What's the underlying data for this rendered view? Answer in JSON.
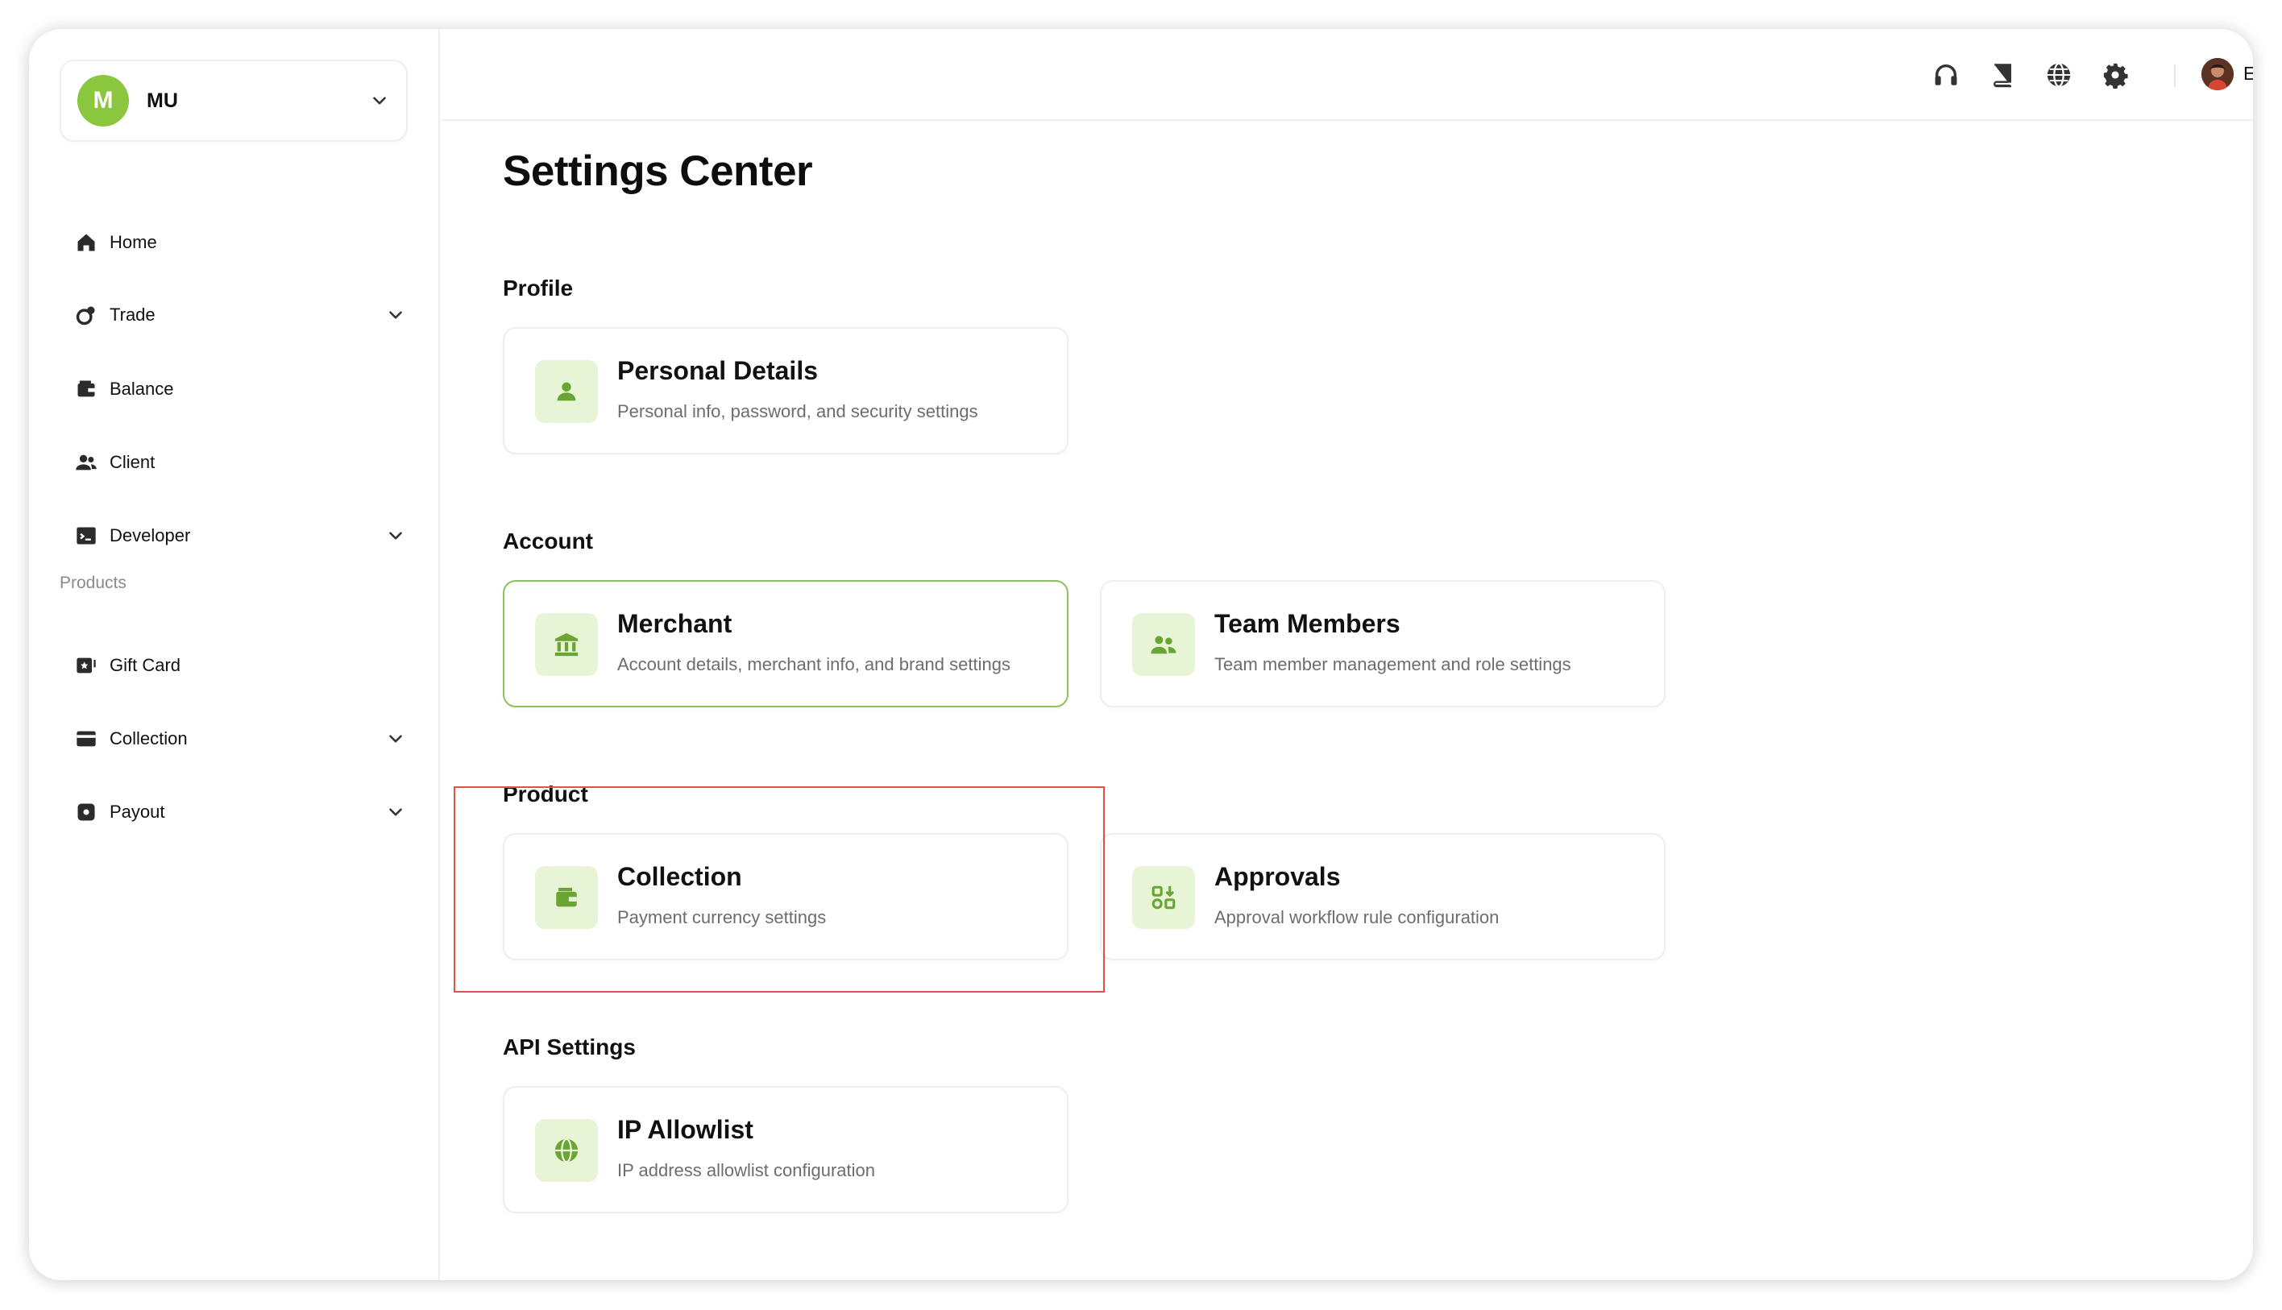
{
  "org": {
    "initial": "M",
    "name": "MU"
  },
  "sidebar": {
    "items": [
      {
        "label": "Home",
        "icon": "home-icon",
        "expandable": false
      },
      {
        "label": "Trade",
        "icon": "trade-icon",
        "expandable": true
      },
      {
        "label": "Balance",
        "icon": "wallet-icon",
        "expandable": false
      },
      {
        "label": "Client",
        "icon": "users-icon",
        "expandable": false
      },
      {
        "label": "Developer",
        "icon": "terminal-icon",
        "expandable": true
      }
    ],
    "products_heading": "Products",
    "product_items": [
      {
        "label": "Gift Card",
        "icon": "gift-card-icon",
        "expandable": false
      },
      {
        "label": "Collection",
        "icon": "card-icon",
        "expandable": true
      },
      {
        "label": "Payout",
        "icon": "payout-icon",
        "expandable": true
      }
    ]
  },
  "header": {
    "icons": [
      "headset-icon",
      "book-icon",
      "globe-icon",
      "gear-icon"
    ],
    "user_name": "Eive"
  },
  "main": {
    "title": "Settings Center",
    "sections": [
      {
        "title": "Profile",
        "cards": [
          {
            "title": "Personal Details",
            "description": "Personal info, password, and security settings",
            "icon": "person-icon"
          }
        ]
      },
      {
        "title": "Account",
        "cards": [
          {
            "title": "Merchant",
            "description": "Account details, merchant info, and brand settings",
            "icon": "bank-icon",
            "active": true
          },
          {
            "title": "Team Members",
            "description": "Team member management and role settings",
            "icon": "team-icon"
          }
        ]
      },
      {
        "title": "Product",
        "cards": [
          {
            "title": "Collection",
            "description": "Payment currency settings",
            "icon": "wallet-icon"
          },
          {
            "title": "Approvals",
            "description": "Approval workflow rule configuration",
            "icon": "approval-icon"
          }
        ]
      },
      {
        "title": "API Settings",
        "cards": [
          {
            "title": "IP Allowlist",
            "description": "IP address allowlist configuration",
            "icon": "globe-icon"
          }
        ]
      }
    ]
  },
  "colors": {
    "accent": "#8bc63f",
    "icon_green": "#6aa534",
    "icon_bg": "#e7f4d6",
    "highlight": "#e0504d",
    "active_border": "#8cc25a"
  }
}
